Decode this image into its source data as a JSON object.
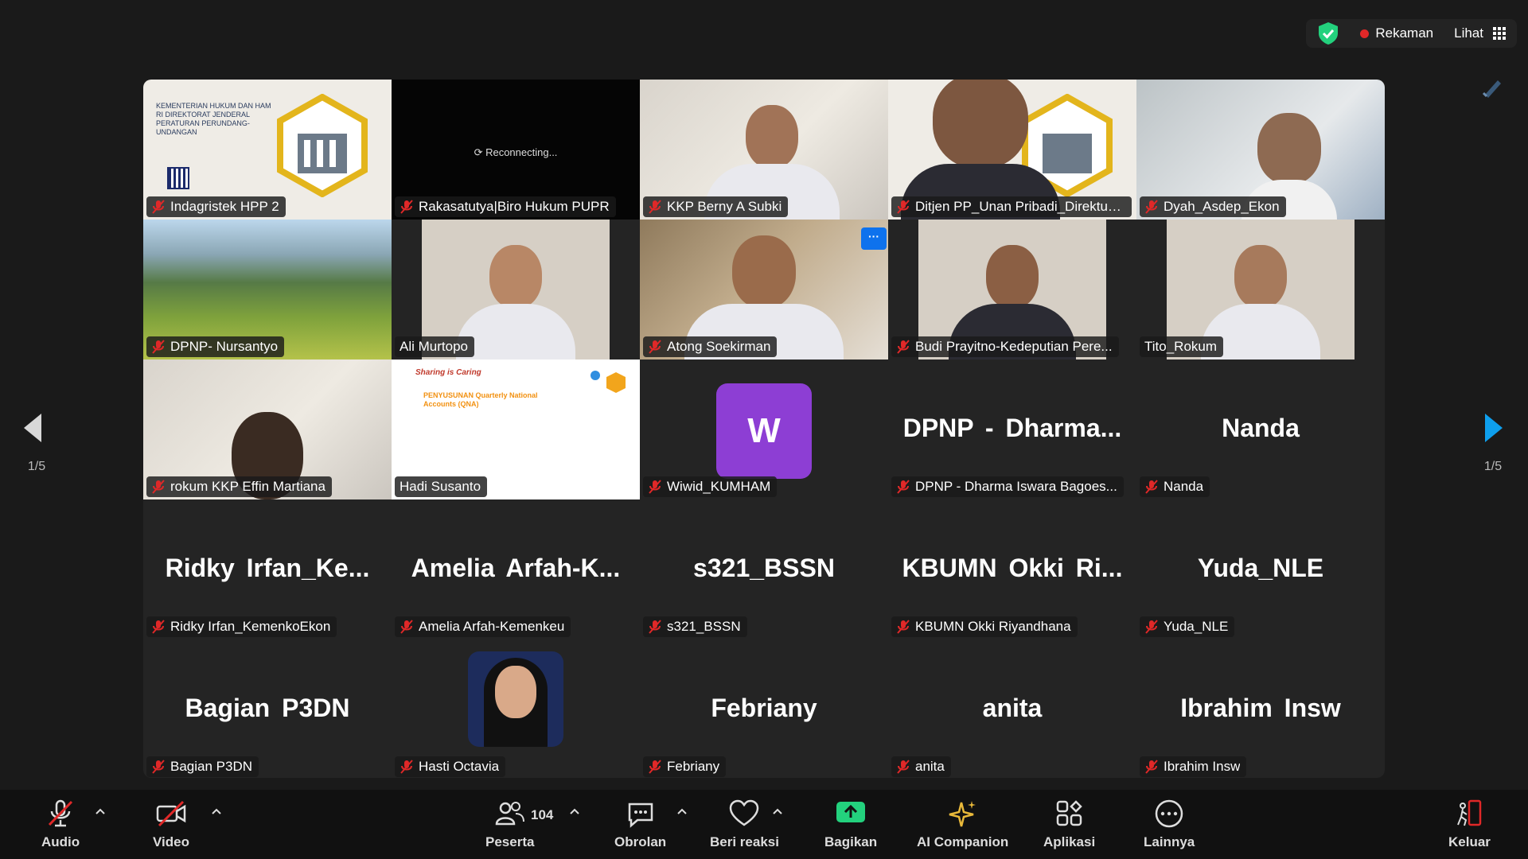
{
  "topbar": {
    "record_label": "Rekaman",
    "view_label": "Lihat"
  },
  "pagination": {
    "left": "1/5",
    "right": "1/5"
  },
  "tiles": [
    {
      "name": "Indagristek HPP 2",
      "slide_text": "KEMENTERIAN HUKUM DAN HAM RI DIREKTORAT JENDERAL PERATURAN PERUNDANG-UNDANGAN"
    },
    {
      "name": "Rakasatutya|Biro Hukum PUPR",
      "status": "Reconnecting..."
    },
    {
      "name": "KKP Berny A Subki"
    },
    {
      "name": "Ditjen PP_Unan Pribadi_Direktur H..."
    },
    {
      "name": "Dyah_Asdep_Ekon"
    },
    {
      "name": "DPNP- Nursantyo"
    },
    {
      "name": "Ali Murtopo"
    },
    {
      "name": "Atong Soekirman",
      "more": "···"
    },
    {
      "name": "Budi Prayitno-Kedeputian Pere..."
    },
    {
      "name": "Tito_Rokum"
    },
    {
      "name": "rokum KKP Effin Martiana"
    },
    {
      "name": "Hadi Susanto",
      "slide_title": "Sharing is Caring",
      "slide_sub": "PENYUSUNAN Quarterly National Accounts (QNA)"
    },
    {
      "name": "Wiwid_KUMHAM",
      "avatar_letter": "W"
    },
    {
      "name": "DPNP - Dharma Iswara Bagoes...",
      "big": "DPNP - Dharma..."
    },
    {
      "name": "Nanda",
      "big": "Nanda"
    },
    {
      "name": "Ridky Irfan_KemenkoEkon",
      "big": "Ridky Irfan_Ke..."
    },
    {
      "name": "Amelia Arfah-Kemenkeu",
      "big": "Amelia Arfah-K..."
    },
    {
      "name": "s321_BSSN",
      "big": "s321_BSSN"
    },
    {
      "name": "KBUMN Okki Riyandhana",
      "big": "KBUMN Okki Ri..."
    },
    {
      "name": "Yuda_NLE",
      "big": "Yuda_NLE"
    },
    {
      "name": "Bagian P3DN",
      "big": "Bagian P3DN"
    },
    {
      "name": "Hasti Octavia"
    },
    {
      "name": "Febriany",
      "big": "Febriany"
    },
    {
      "name": "anita",
      "big": "anita"
    },
    {
      "name": "Ibrahim Insw",
      "big": "Ibrahim Insw"
    }
  ],
  "toolbar": {
    "audio": "Audio",
    "video": "Video",
    "participants": "Peserta",
    "participants_count": "104",
    "chat": "Obrolan",
    "react": "Beri reaksi",
    "share": "Bagikan",
    "ai": "AI Companion",
    "apps": "Aplikasi",
    "more": "Lainnya",
    "leave": "Keluar"
  },
  "colors": {
    "active_speaker": "#23d17d",
    "share_green": "#23d17d",
    "avatar_purple": "#8d3ed4",
    "record_red": "#e02828",
    "nav_blue": "#0e9fed",
    "muted_red": "#e02828"
  }
}
